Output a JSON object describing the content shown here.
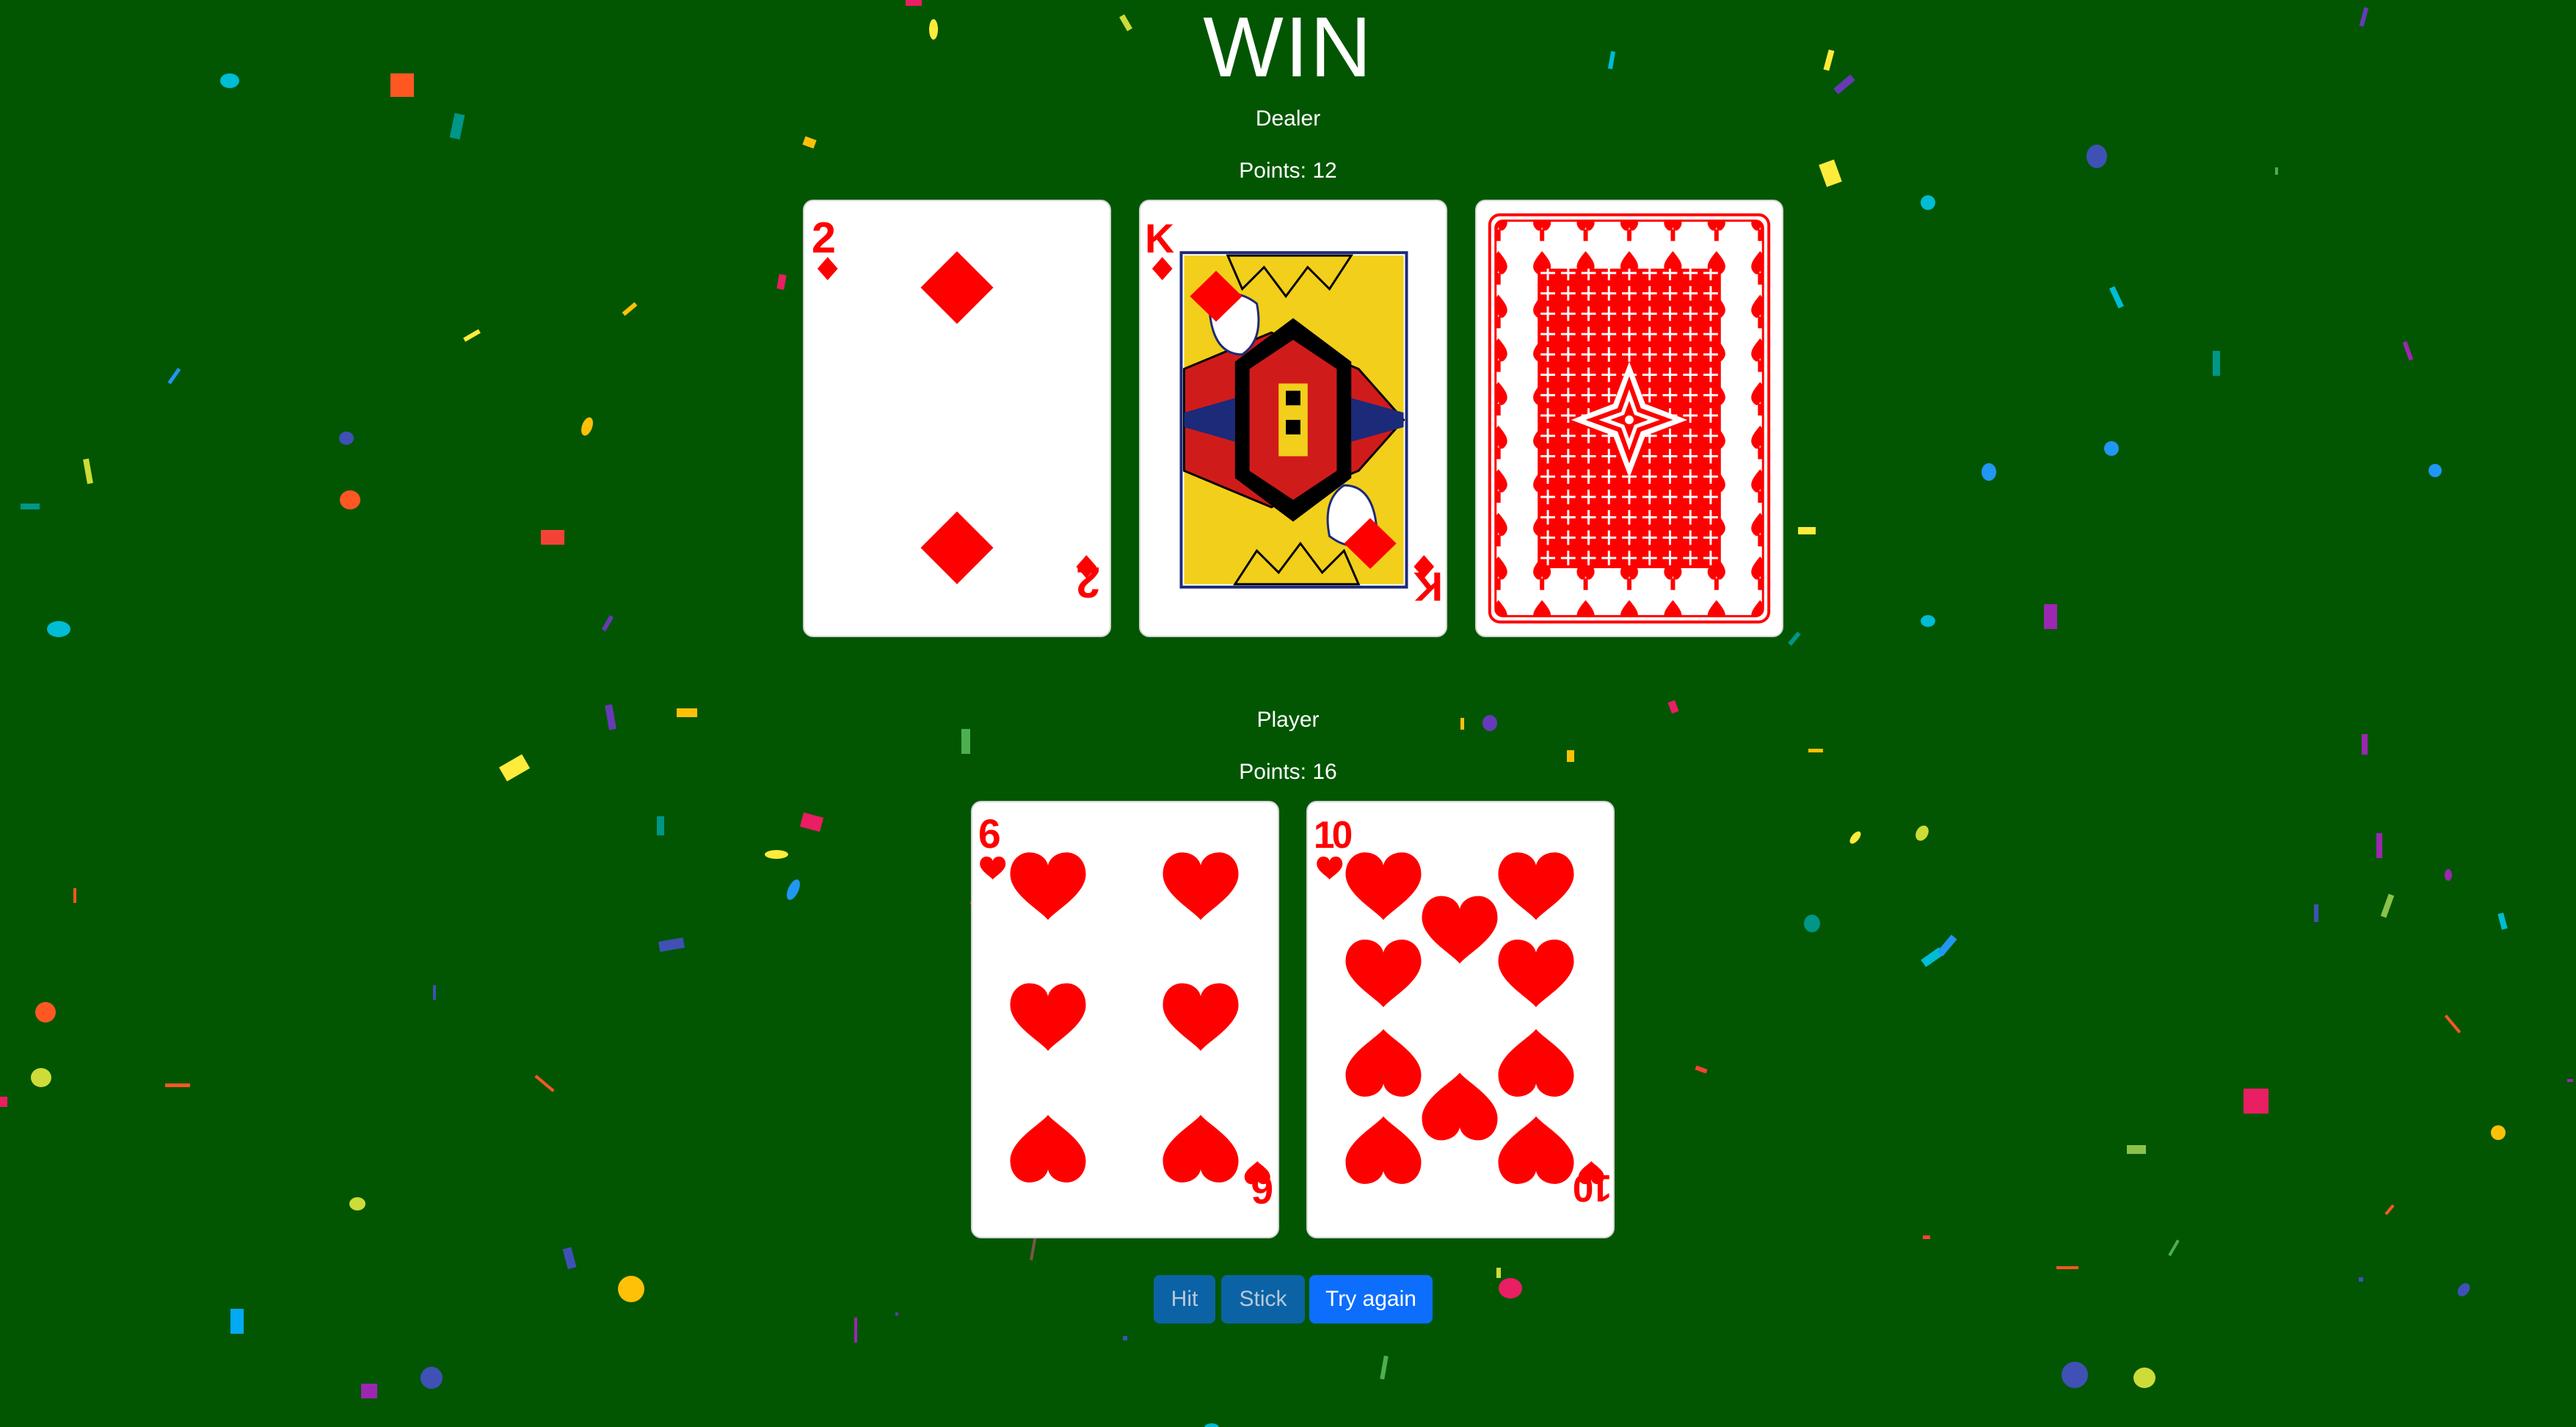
{
  "result": "WIN",
  "dealer": {
    "label": "Dealer",
    "points_text": "Points: 12",
    "cards": [
      {
        "rank": "2",
        "suit": "diamonds",
        "face_up": true
      },
      {
        "rank": "K",
        "suit": "diamonds",
        "face_up": true
      },
      {
        "rank": "",
        "suit": "",
        "face_up": false
      }
    ]
  },
  "player": {
    "label": "Player",
    "points_text": "Points: 16",
    "cards": [
      {
        "rank": "6",
        "suit": "hearts",
        "face_up": true
      },
      {
        "rank": "10",
        "suit": "hearts",
        "face_up": true
      }
    ]
  },
  "buttons": {
    "hit": "Hit",
    "stick": "Stick",
    "try_again": "Try again"
  },
  "colors": {
    "table": "#025602",
    "card_red": "#ff0000",
    "button_primary": "#0d6efd",
    "button_disabled": "#0b63a6"
  }
}
